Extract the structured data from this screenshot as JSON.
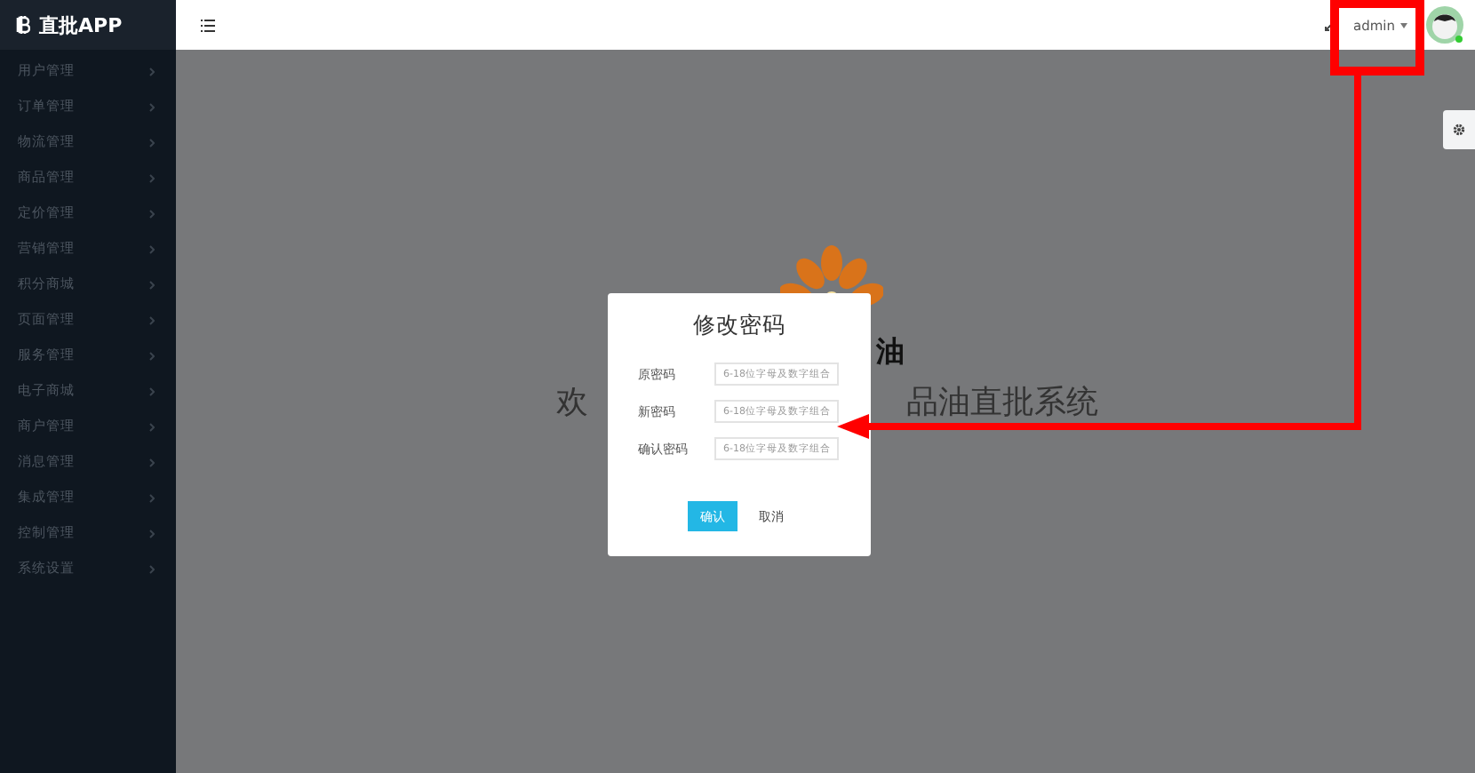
{
  "app": {
    "logo_text": "直批APP"
  },
  "sidebar": {
    "items": [
      {
        "label": "用户管理"
      },
      {
        "label": "订单管理"
      },
      {
        "label": "物流管理"
      },
      {
        "label": "商品管理"
      },
      {
        "label": "定价管理"
      },
      {
        "label": "营销管理"
      },
      {
        "label": "积分商城"
      },
      {
        "label": "页面管理"
      },
      {
        "label": "服务管理"
      },
      {
        "label": "电子商城"
      },
      {
        "label": "商户管理"
      },
      {
        "label": "消息管理"
      },
      {
        "label": "集成管理"
      },
      {
        "label": "控制管理"
      },
      {
        "label": "系统设置"
      }
    ]
  },
  "topbar": {
    "user": "admin"
  },
  "welcome": {
    "fragment_top": "油",
    "fragment_left": "欢",
    "fragment_right": "品油直批系统"
  },
  "dialog": {
    "title": "修改密码",
    "fields": [
      {
        "label": "原密码",
        "placeholder": "6-18位字母及数字组合"
      },
      {
        "label": "新密码",
        "placeholder": "6-18位字母及数字组合"
      },
      {
        "label": "确认密码",
        "placeholder": "6-18位字母及数字组合"
      }
    ],
    "buttons": [
      {
        "label": "确认",
        "kind": "primary"
      },
      {
        "label": "取消",
        "kind": "link"
      }
    ]
  }
}
